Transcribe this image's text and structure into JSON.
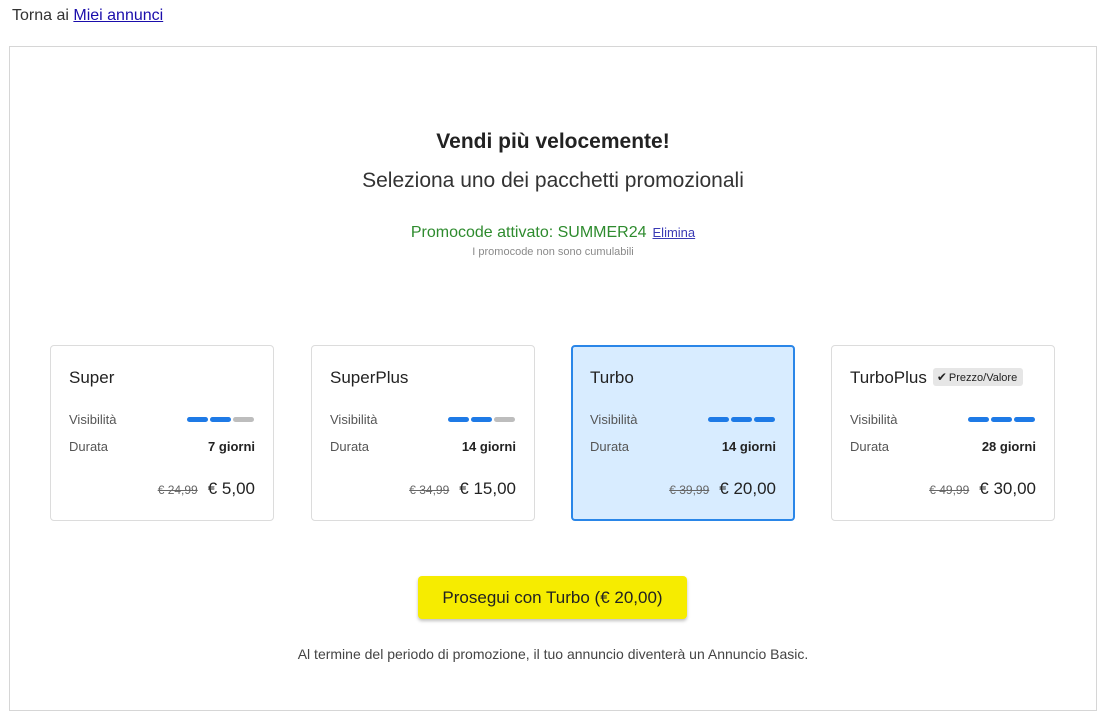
{
  "back": {
    "prefix": "Torna ai",
    "link_label": "Miei annunci"
  },
  "header": {
    "title": "Vendi più velocemente!",
    "subtitle": "Seleziona uno dei pacchetti promozionali"
  },
  "promo": {
    "status_text": "Promocode attivato: SUMMER24",
    "remove_label": "Elimina",
    "note": "I promocode non sono cumulabili",
    "color": "#2e8b2e"
  },
  "packages": [
    {
      "name": "Super",
      "badge": "",
      "visibility_label": "Visibilità",
      "visibility_level": 2,
      "visibility_max": 3,
      "duration_label": "Durata",
      "duration": "7 giorni",
      "old_price": "€ 24,99",
      "price": "€ 5,00",
      "selected": false
    },
    {
      "name": "SuperPlus",
      "badge": "",
      "visibility_label": "Visibilità",
      "visibility_level": 2,
      "visibility_max": 3,
      "duration_label": "Durata",
      "duration": "14 giorni",
      "old_price": "€ 34,99",
      "price": "€ 15,00",
      "selected": false
    },
    {
      "name": "Turbo",
      "badge": "",
      "visibility_label": "Visibilità",
      "visibility_level": 3,
      "visibility_max": 3,
      "duration_label": "Durata",
      "duration": "14 giorni",
      "old_price": "€ 39,99",
      "price": "€ 20,00",
      "selected": true
    },
    {
      "name": "TurboPlus",
      "badge": "Prezzo/Valore",
      "badge_icon": "check-icon",
      "visibility_label": "Visibilità",
      "visibility_level": 3,
      "visibility_max": 3,
      "duration_label": "Durata",
      "duration": "28 giorni",
      "old_price": "€ 49,99",
      "price": "€ 30,00",
      "selected": false
    }
  ],
  "cta": {
    "label": "Prosegui con Turbo (€ 20,00)",
    "color": "#f6ec00"
  },
  "footer": {
    "note": "Al termine del periodo di promozione, il tuo annuncio diventerà un Annuncio Basic."
  },
  "colors": {
    "accent": "#1e7ae6",
    "selected_bg": "#d8ecff",
    "link": "#1a0dab"
  }
}
